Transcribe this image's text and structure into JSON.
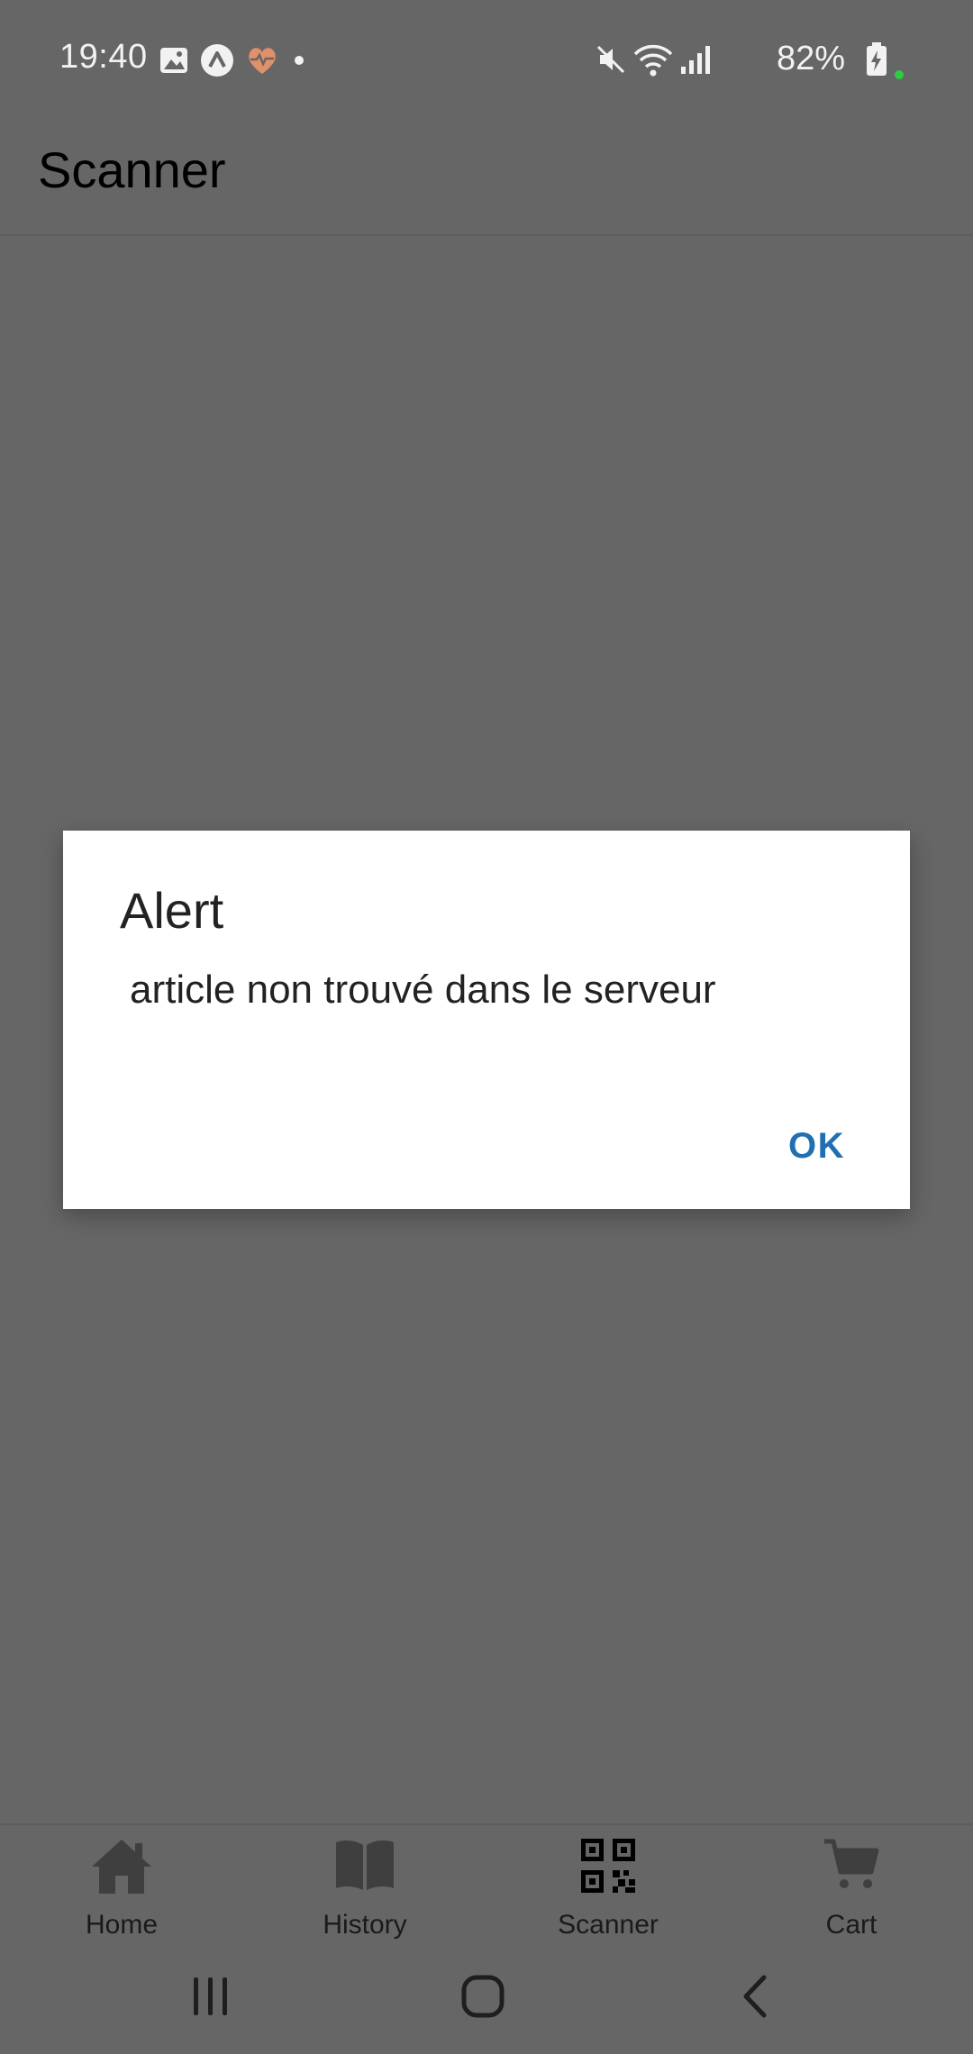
{
  "status_bar": {
    "time": "19:40",
    "battery": "82%",
    "left_icons": [
      "gallery-icon",
      "expo-icon",
      "health-icon",
      "dot-icon"
    ],
    "right_icons": [
      "mute-icon",
      "wifi-icon",
      "signal-icon",
      "battery-charging-icon"
    ],
    "indicator_color": "#2ecc40"
  },
  "header": {
    "title": "Scanner"
  },
  "dialog": {
    "title": "Alert",
    "message": "article non trouvé dans le serveur",
    "ok_label": "OK",
    "ok_color": "#1f6fb2"
  },
  "tabs": [
    {
      "label": "Home",
      "icon": "home-icon",
      "active": false
    },
    {
      "label": "History",
      "icon": "book-icon",
      "active": false
    },
    {
      "label": "Scanner",
      "icon": "qr-code-icon",
      "active": true
    },
    {
      "label": "Cart",
      "icon": "cart-icon",
      "active": false
    }
  ],
  "system_nav": [
    "recents-icon",
    "home-circle-icon",
    "back-icon"
  ],
  "colors": {
    "scrim_background": "#666666",
    "dialog_background": "#ffffff",
    "inactive_tab_icon": "#3f3f3f",
    "active_tab_icon": "#000000"
  }
}
